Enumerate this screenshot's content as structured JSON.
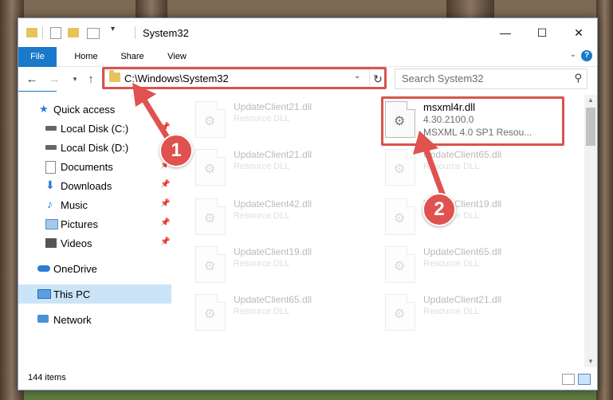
{
  "window": {
    "title": "System32",
    "controls": {
      "minimize": "—",
      "maximize": "☐",
      "close": "✕"
    }
  },
  "ribbon": {
    "tabs": [
      "File",
      "Home",
      "Share",
      "View"
    ],
    "help": "?"
  },
  "navigation": {
    "address_path": "C:\\Windows\\System32",
    "search_placeholder": "Search System32"
  },
  "sidebar": {
    "items": [
      {
        "label": "Quick access",
        "icon": "star-icon",
        "pinned": false
      },
      {
        "label": "Local Disk (C:)",
        "icon": "drive-icon",
        "pinned": true
      },
      {
        "label": "Local Disk (D:)",
        "icon": "drive-icon",
        "pinned": false
      },
      {
        "label": "Documents",
        "icon": "documents-icon",
        "pinned": true
      },
      {
        "label": "Downloads",
        "icon": "download-icon",
        "pinned": true
      },
      {
        "label": "Music",
        "icon": "music-icon",
        "pinned": true
      },
      {
        "label": "Pictures",
        "icon": "pictures-icon",
        "pinned": true
      },
      {
        "label": "Videos",
        "icon": "videos-icon",
        "pinned": true
      },
      {
        "label": "OneDrive",
        "icon": "cloud-icon",
        "pinned": false
      },
      {
        "label": "This PC",
        "icon": "computer-icon",
        "pinned": false,
        "selected": true
      },
      {
        "label": "Network",
        "icon": "network-icon",
        "pinned": false
      }
    ]
  },
  "files": {
    "left_column": [
      {
        "name": "UpdateClient21.dll",
        "type": "Resource DLL"
      },
      {
        "name": "UpdateClient21.dll",
        "type": "Resource DLL"
      },
      {
        "name": "UpdateClient42.dll",
        "type": "Resource DLL"
      },
      {
        "name": "UpdateClient19.dll",
        "type": "Resource DLL"
      },
      {
        "name": "UpdateClient65.dll",
        "type": "Resource DLL"
      }
    ],
    "highlighted": {
      "name": "msxml4r.dll",
      "version": "4.30.2100.0",
      "description": "MSXML 4.0 SP1 Resou..."
    },
    "right_column": [
      {
        "name": "UpdateClient65.dll",
        "type": "Resource DLL"
      },
      {
        "name": "UpdateClient19.dll",
        "type": "Resource DLL"
      },
      {
        "name": "UpdateClient65.dll",
        "type": "Resource DLL"
      },
      {
        "name": "UpdateClient21.dll",
        "type": "Resource DLL"
      }
    ]
  },
  "status": {
    "item_count": "144 items"
  },
  "annotations": {
    "callout_1": "1",
    "callout_2": "2"
  },
  "colors": {
    "accent": "#1979ca",
    "highlight": "#d9534f",
    "callout": "#e0524f",
    "selected": "#cce4f7"
  }
}
